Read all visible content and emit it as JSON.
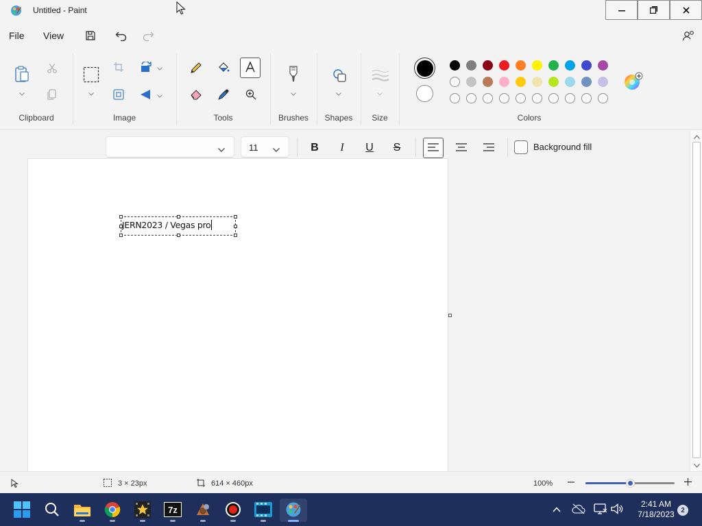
{
  "window": {
    "title": "Untitled - Paint",
    "controls": [
      "minimize-icon",
      "restore-icon",
      "close-icon"
    ]
  },
  "menu": {
    "file": "File",
    "view": "View",
    "save_icon": "save-icon",
    "undo_icon": "undo-icon",
    "redo_icon": "redo-icon",
    "settings_icon": "account-settings-icon"
  },
  "ribbon": {
    "groups": {
      "clipboard": "Clipboard",
      "image": "Image",
      "tools": "Tools",
      "brushes": "Brushes",
      "shapes": "Shapes",
      "size": "Size",
      "colors": "Colors"
    },
    "active_tool": "text",
    "colors": {
      "primary": "#000000",
      "secondary": "#ffffff",
      "palette_row1": [
        "#000000",
        "#7f7f7f",
        "#880015",
        "#ed1c24",
        "#ff7f27",
        "#fff200",
        "#22b14c",
        "#00a2e8",
        "#3f48cc",
        "#a349a4"
      ],
      "palette_row2": [
        "#ffffff",
        "#c3c3c3",
        "#b97a57",
        "#ffaec9",
        "#ffc90e",
        "#efe4b0",
        "#b5e61d",
        "#99d9ea",
        "#7092be",
        "#c8bfe7"
      ],
      "palette_row3_custom_slots": 10
    }
  },
  "text_toolbar": {
    "font_family": "",
    "font_size": "11",
    "bold": "B",
    "italic": "I",
    "underline": "U",
    "strikethrough": "S",
    "alignment": "left",
    "background_fill_label": "Background fill",
    "background_fill_checked": false
  },
  "canvas": {
    "text_content": "JERN2023 / Vegas pro"
  },
  "status": {
    "selection_size": "3 × 23px",
    "canvas_size": "614 × 460px",
    "zoom": "100%",
    "zoom_fraction": 0.5
  },
  "taskbar": {
    "apps": [
      "start-icon",
      "search-icon",
      "file-explorer-icon",
      "chrome-icon",
      "movie-star-icon",
      "7zip-icon",
      "media-app-icon",
      "record-icon",
      "video-editor-icon",
      "paint-icon"
    ],
    "active_app": "paint-icon",
    "time": "2:41 AM",
    "date": "7/18/2023",
    "notifications": "2"
  }
}
